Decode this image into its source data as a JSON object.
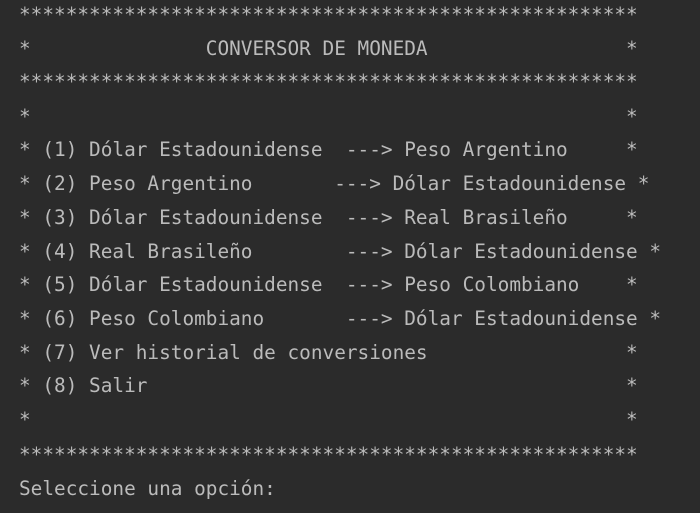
{
  "console": {
    "lines": [
      "*****************************************************",
      "*               CONVERSOR DE MONEDA                 *",
      "*****************************************************",
      "*                                                   *",
      "* (1) Dólar Estadounidense  ---> Peso Argentino     *",
      "* (2) Peso Argentino       ---> Dólar Estadounidense *",
      "* (3) Dólar Estadounidense  ---> Real Brasileño     *",
      "* (4) Real Brasileño        ---> Dólar Estadounidense *",
      "* (5) Dólar Estadounidense  ---> Peso Colombiano    *",
      "* (6) Peso Colombiano       ---> Dólar Estadounidense *",
      "* (7) Ver historial de conversiones                 *",
      "* (8) Salir                                         *",
      "*                                                   *",
      "*****************************************************",
      "Seleccione una opción: "
    ]
  },
  "colors": {
    "background": "#2b2b2b",
    "text": "#bbbbbb"
  }
}
